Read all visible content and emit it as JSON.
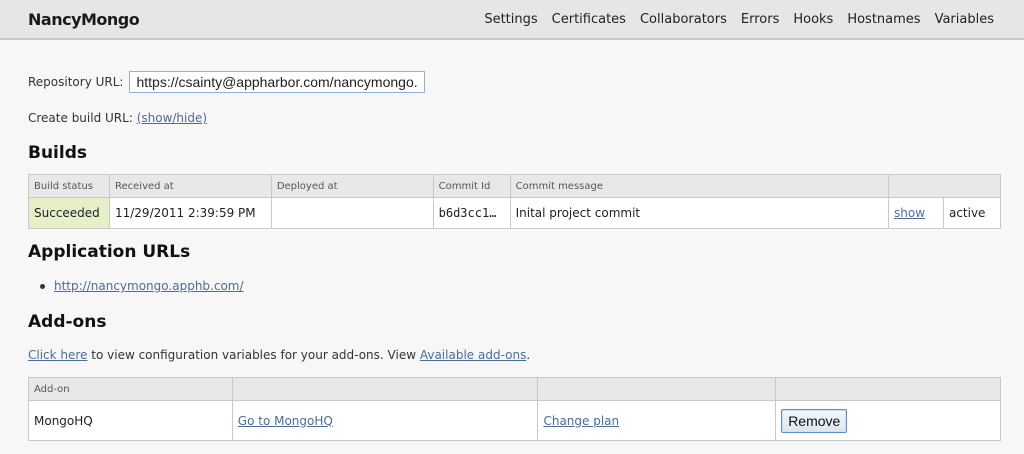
{
  "header": {
    "brand": "NancyMongo",
    "nav": [
      "Settings",
      "Certificates",
      "Collaborators",
      "Errors",
      "Hooks",
      "Hostnames",
      "Variables"
    ]
  },
  "repository": {
    "label": "Repository URL:",
    "value": "https://csainty@appharbor.com/nancymongo.git"
  },
  "build_url": {
    "label": "Create build URL:",
    "toggle": "(show/hide)"
  },
  "builds": {
    "title": "Builds",
    "columns": [
      "Build status",
      "Received at",
      "Deployed at",
      "Commit Id",
      "Commit message",
      "",
      ""
    ],
    "rows": [
      {
        "status": "Succeeded",
        "received_at": "11/29/2011 2:39:59 PM",
        "deployed_at": "",
        "commit_id": "b6d3cc1…",
        "commit_message": "Inital project commit",
        "action": "show",
        "state": "active"
      }
    ]
  },
  "application_urls": {
    "title": "Application URLs",
    "items": [
      "http://nancymongo.apphb.com/"
    ]
  },
  "addons": {
    "title": "Add-ons",
    "description": {
      "link1": "Click here",
      "text1": " to view configuration variables for your add-ons. View ",
      "link2": "Available add-ons",
      "text2": "."
    },
    "columns": [
      "Add-on",
      "",
      "",
      ""
    ],
    "rows": [
      {
        "name": "MongoHQ",
        "go_to": "Go to MongoHQ",
        "change_plan": "Change plan",
        "remove": "Remove"
      }
    ]
  }
}
